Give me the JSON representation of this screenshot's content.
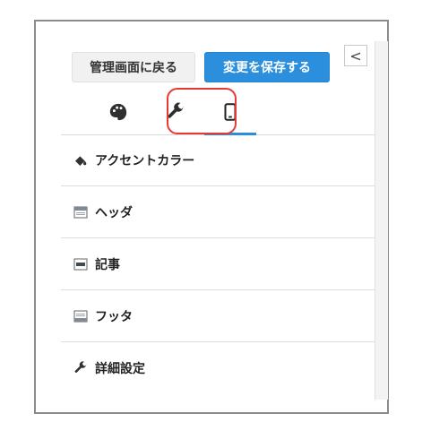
{
  "toolbar": {
    "back_label": "管理画面に戻る",
    "save_label": "変更を保存する",
    "collapse_glyph": "<"
  },
  "tabs": [
    {
      "icon": "palette-icon"
    },
    {
      "icon": "wrench-icon"
    },
    {
      "icon": "mobile-icon",
      "active": true
    }
  ],
  "menu": {
    "items": [
      {
        "label": "アクセントカラー",
        "icon": "paint-bucket-icon"
      },
      {
        "label": "ヘッダ",
        "icon": "layout-header-icon"
      },
      {
        "label": "記事",
        "icon": "layout-article-icon"
      },
      {
        "label": "フッタ",
        "icon": "layout-footer-icon"
      },
      {
        "label": "詳細設定",
        "icon": "wrench-icon"
      }
    ]
  },
  "colors": {
    "accent": "#2b8fdd",
    "highlight": "#e53935"
  }
}
